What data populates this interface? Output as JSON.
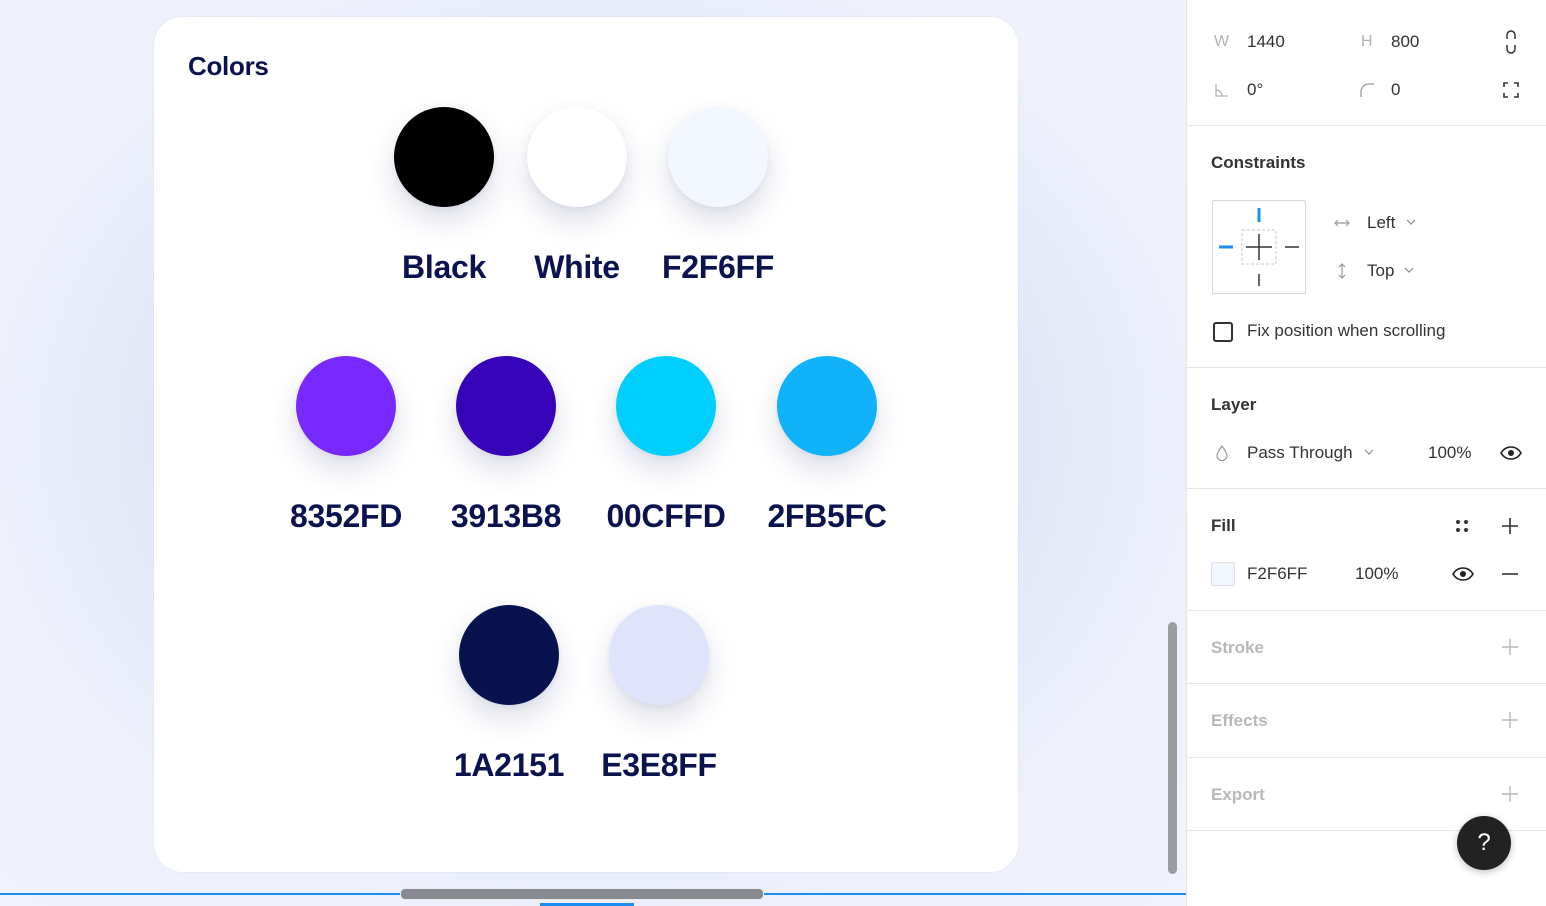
{
  "frame": {
    "title": "Colors",
    "swatches": [
      {
        "label": "Black",
        "color": "#000000"
      },
      {
        "label": "White",
        "color": "#ffffff"
      },
      {
        "label": "F2F6FF",
        "color": "#f2f6ff"
      },
      {
        "label": "8352FD",
        "color": "#7829fd"
      },
      {
        "label": "3913B8",
        "color": "#3603b9"
      },
      {
        "label": "00CFFD",
        "color": "#00cffd"
      },
      {
        "label": "2FB5FC",
        "color": "#10b2f9"
      },
      {
        "label": "1A2151",
        "color": "#07124f"
      },
      {
        "label": "E3E8FF",
        "color": "#dfe3fc"
      }
    ]
  },
  "panel": {
    "w_label": "W",
    "w_value": "1440",
    "h_label": "H",
    "h_value": "800",
    "rotation_value": "0°",
    "radius_value": "0",
    "constraints": {
      "title": "Constraints",
      "horizontal": "Left",
      "vertical": "Top",
      "fix_position_label": "Fix position when scrolling"
    },
    "layer": {
      "title": "Layer",
      "blend_mode": "Pass Through",
      "opacity": "100%"
    },
    "fill": {
      "title": "Fill",
      "hex": "F2F6FF",
      "opacity": "100%",
      "swatch_color": "#f2f6ff"
    },
    "stroke_title": "Stroke",
    "effects_title": "Effects",
    "export_title": "Export",
    "help_label": "?"
  },
  "colors": {
    "accent": "#1e8df0",
    "text_dark": "#0b1250"
  }
}
